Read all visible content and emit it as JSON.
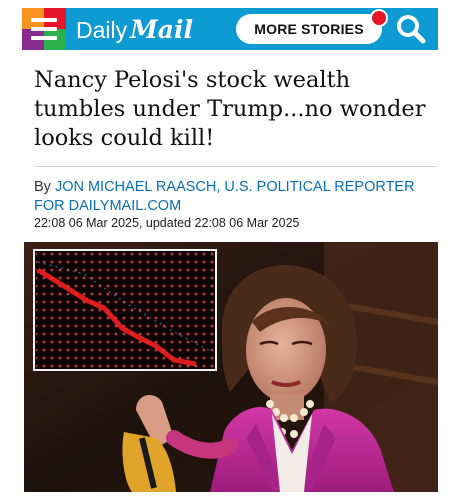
{
  "header": {
    "logo_daily": "Daily",
    "logo_mail": "Mail",
    "more_stories_label": "MORE STORIES"
  },
  "article": {
    "headline": "Nancy Pelosi's stock wealth tumbles under Trump...no wonder looks could kill!",
    "byline_prefix": "By",
    "author": "JON MICHAEL RAASCH, U.S. POLITICAL REPORTER FOR DAILYMAIL.COM",
    "timestamp": "22:08 06 Mar 2025, updated 22:08 06 Mar 2025"
  },
  "colors": {
    "brand_blue": "#0e9ad3",
    "byline_link": "#0a6fb7",
    "notification_red": "#e5152a"
  },
  "icons": [
    "menu-icon",
    "search-icon"
  ]
}
